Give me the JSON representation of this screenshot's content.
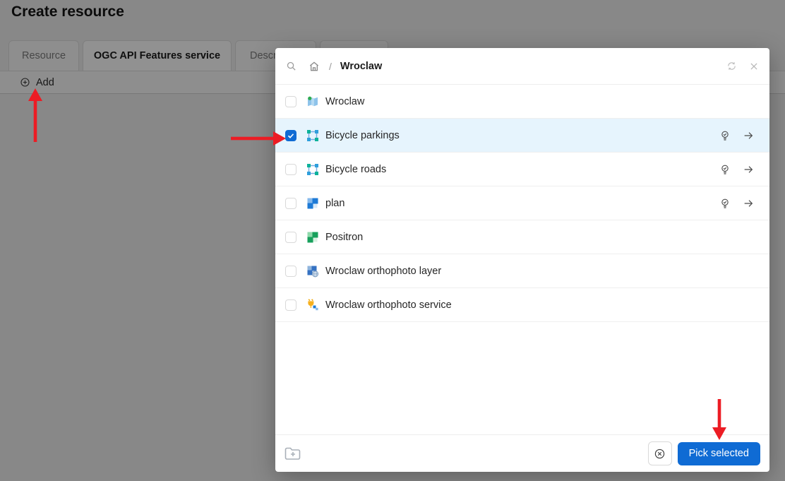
{
  "page": {
    "title": "Create resource",
    "tabs": [
      {
        "label": "Resource",
        "active": false
      },
      {
        "label": "OGC API Features service",
        "active": true
      },
      {
        "label": "Descr",
        "active": false,
        "note": "truncated-by-modal"
      },
      {
        "label": "",
        "active": false,
        "note": "hidden-by-modal"
      }
    ],
    "toolbar": {
      "add": "Add"
    }
  },
  "modal": {
    "breadcrumb": {
      "separator": "/",
      "current": "Wroclaw"
    },
    "header_icons": [
      "search-icon",
      "home-icon",
      "sync-icon",
      "close-icon"
    ],
    "rows": [
      {
        "label": "Wroclaw",
        "icon": "webmap-icon",
        "checked": false,
        "selected": false,
        "has_actions": false
      },
      {
        "label": "Bicycle parkings",
        "icon": "vector-layer-icon",
        "checked": true,
        "selected": true,
        "has_actions": true
      },
      {
        "label": "Bicycle roads",
        "icon": "vector-layer-icon",
        "checked": false,
        "selected": false,
        "has_actions": true
      },
      {
        "label": "plan",
        "icon": "basemap-blue-icon",
        "checked": false,
        "selected": false,
        "has_actions": true
      },
      {
        "label": "Positron",
        "icon": "basemap-green-icon",
        "checked": false,
        "selected": false,
        "has_actions": false
      },
      {
        "label": "Wroclaw orthophoto layer",
        "icon": "raster-layer-icon",
        "checked": false,
        "selected": false,
        "has_actions": false
      },
      {
        "label": "Wroclaw orthophoto service",
        "icon": "wms-service-icon",
        "checked": false,
        "selected": false,
        "has_actions": false
      }
    ],
    "footer": {
      "pick": "Pick selected",
      "icons": [
        "folder-add-icon",
        "clear-selection-icon"
      ]
    }
  },
  "annotations": {
    "arrow_color": "#ec1c24",
    "arrows": [
      {
        "direction": "up",
        "points_at": "add-button"
      },
      {
        "direction": "right",
        "points_at": "bicycle-parkings-checkbox"
      },
      {
        "direction": "down",
        "points_at": "pick-selected-button"
      }
    ]
  },
  "colors": {
    "primary": "#0f6bd4",
    "selected_row_bg": "#e6f4fd",
    "mask": "rgba(0,0,0,0.43)"
  }
}
